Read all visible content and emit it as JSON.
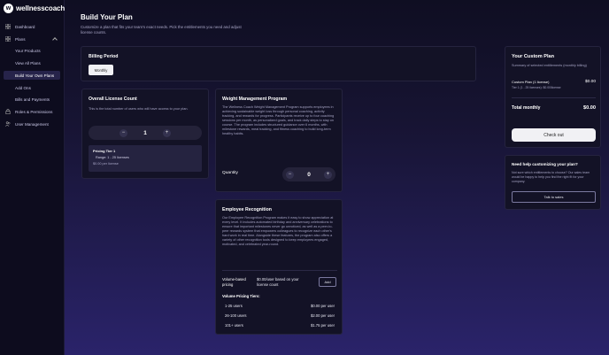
{
  "brand": {
    "name": "wellnesscoach",
    "mark": "w"
  },
  "sidebar": {
    "items": [
      {
        "label": "Dashboard"
      },
      {
        "label": "Plans"
      },
      {
        "label": "Your Products"
      },
      {
        "label": "View All Plans"
      },
      {
        "label": "Build Your Own Plans"
      },
      {
        "label": "Add Ons"
      },
      {
        "label": "Bills and Payments"
      },
      {
        "label": "Roles & Permissions"
      },
      {
        "label": "User Management"
      }
    ]
  },
  "header": {
    "title": "Build Your Plan",
    "subtitle": "Customize a plan that fits your team's exact needs. Pick the entitlements you need and adjust license counts."
  },
  "billing": {
    "title": "Billing Period",
    "option": "Monthly"
  },
  "license": {
    "title": "Overall License Count",
    "description": "This is the total number of users who will have access to your plan.",
    "count": "1",
    "minus": "−",
    "plus": "+",
    "tier_title": "Pricing Tier 1",
    "tier_range": "Range: 1 - 25 licenses",
    "tier_price": "$0.00 per license"
  },
  "weight": {
    "title": "Weight Management Program",
    "description": "The Wellness Coach Weight Management Program supports employees in achieving sustainable weight loss through personal coaching, activity tracking, and rewards for progress. Participants receive up to four coaching sessions per month, as personalized goals, and track daily steps to stay on course. The program includes structured guidance over 6 months, with milestone rewards, meal tracking, and fitness coaching to build long-term healthy habits.",
    "quantity_label": "Quantity",
    "quantity": "0",
    "minus": "−",
    "plus": "+"
  },
  "recognition": {
    "title": "Employee Recognition",
    "description": "Our Employee Recognition Program makes it easy to show appreciation at every level. It includes automated birthday and anniversary celebrations to ensure that important milestones never go unnoticed, as well as a peer-to-peer rewards system that empowers colleagues to recognize each other's hard work in real time. Alongside these features, the program also offers a variety of other recognition tools designed to keep employees engaged, motivated, and celebrated year-round.",
    "pricing_label": "Volume-based pricing",
    "pricing_value": "$0.00/user based on your license count",
    "add_label": "Add",
    "tiers_heading": "Volume Pricing Tiers:",
    "tiers": [
      {
        "users": "1-25 users",
        "price": "$0.00 per user"
      },
      {
        "users": "26-100 users",
        "price": "$2.00 per user"
      },
      {
        "users": "101+ users",
        "price": "$1.75 per user"
      }
    ]
  },
  "summary": {
    "title": "Your Custom Plan",
    "subtitle": "Summary of selected entitlements (monthly billing)",
    "line_name": "Custom Plan (1 license)",
    "line_price": "$0.00",
    "line_detail": "Tier 1 (1 - 25 licenses): $0.00/license",
    "total_label": "Total monthly",
    "total_value": "$0.00",
    "checkout_label": "Check out"
  },
  "help": {
    "title": "Need help customizing your plan?",
    "description": "Not sure which entitlements to choose? Our sales team would be happy to help you find the right fit for your company.",
    "button_label": "Talk to sales"
  }
}
